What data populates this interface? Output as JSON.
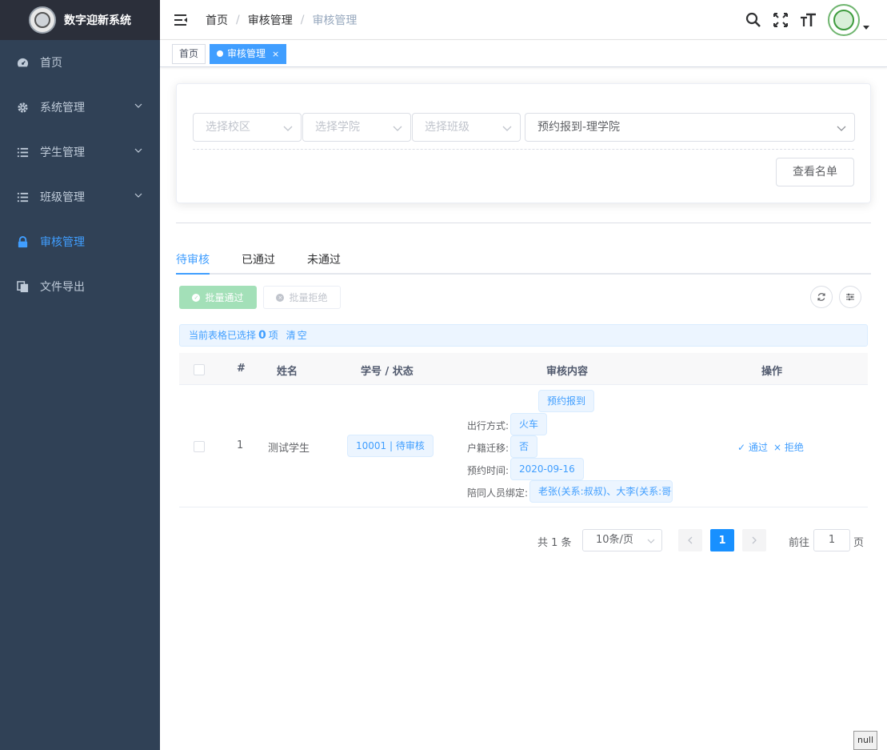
{
  "app": {
    "title": "数字迎新系统"
  },
  "sidebar": {
    "items": [
      {
        "label": "首页",
        "icon": "dashboard-icon",
        "has_children": false,
        "active": false
      },
      {
        "label": "系统管理",
        "icon": "gear-icon",
        "has_children": true,
        "active": false
      },
      {
        "label": "学生管理",
        "icon": "list-icon",
        "has_children": true,
        "active": false
      },
      {
        "label": "班级管理",
        "icon": "list-icon",
        "has_children": true,
        "active": false
      },
      {
        "label": "审核管理",
        "icon": "lock-icon",
        "has_children": false,
        "active": true
      },
      {
        "label": "文件导出",
        "icon": "documents-icon",
        "has_children": false,
        "active": false
      }
    ]
  },
  "header": {
    "breadcrumb": [
      "首页",
      "审核管理",
      "审核管理"
    ],
    "separator": "/"
  },
  "tagsview": {
    "tags": [
      {
        "label": "首页",
        "active": false
      },
      {
        "label": "审核管理",
        "active": true,
        "close": "×"
      }
    ]
  },
  "filters": {
    "campus_placeholder": "选择校区",
    "college_placeholder": "选择学院",
    "class_placeholder": "选择班级",
    "task_value": "预约报到-理学院",
    "view_list_button": "查看名单"
  },
  "tabs": [
    {
      "label": "待审核",
      "active": true
    },
    {
      "label": "已通过",
      "active": false
    },
    {
      "label": "未通过",
      "active": false
    }
  ],
  "toolbar": {
    "batch_pass": "批量通过",
    "batch_reject": "批量拒绝"
  },
  "alert": {
    "prefix": "当前表格已选择",
    "count": "0",
    "suffix": "项",
    "clear": "清空"
  },
  "table": {
    "headers": [
      "#",
      "姓名",
      "学号 / 状态",
      "审核内容",
      "操作"
    ],
    "rows": [
      {
        "index": "1",
        "name": "测试学生",
        "id_status": "10001 | 待审核",
        "content_title": "预约报到",
        "fields": [
          {
            "label": "出行方式:",
            "value": "火车"
          },
          {
            "label": "户籍迁移:",
            "value": "否"
          },
          {
            "label": "预约时间:",
            "value": "2020-09-16"
          },
          {
            "label": "陪同人员绑定:",
            "value": "老张(关系:叔叔)、大李(关系:哥哥)"
          }
        ],
        "pass": "通过",
        "reject": "拒绝"
      }
    ]
  },
  "pagination": {
    "total": "共 1 条",
    "page_size": "10条/页",
    "current": "1",
    "goto_prefix": "前往",
    "goto_value": "1",
    "goto_suffix": "页"
  },
  "debug_label": "null",
  "colors": {
    "sidebar_bg": "#304156",
    "logo_bg": "#2b2f3a",
    "primary": "#409eff",
    "success_disabled": "#a3e0b8"
  }
}
